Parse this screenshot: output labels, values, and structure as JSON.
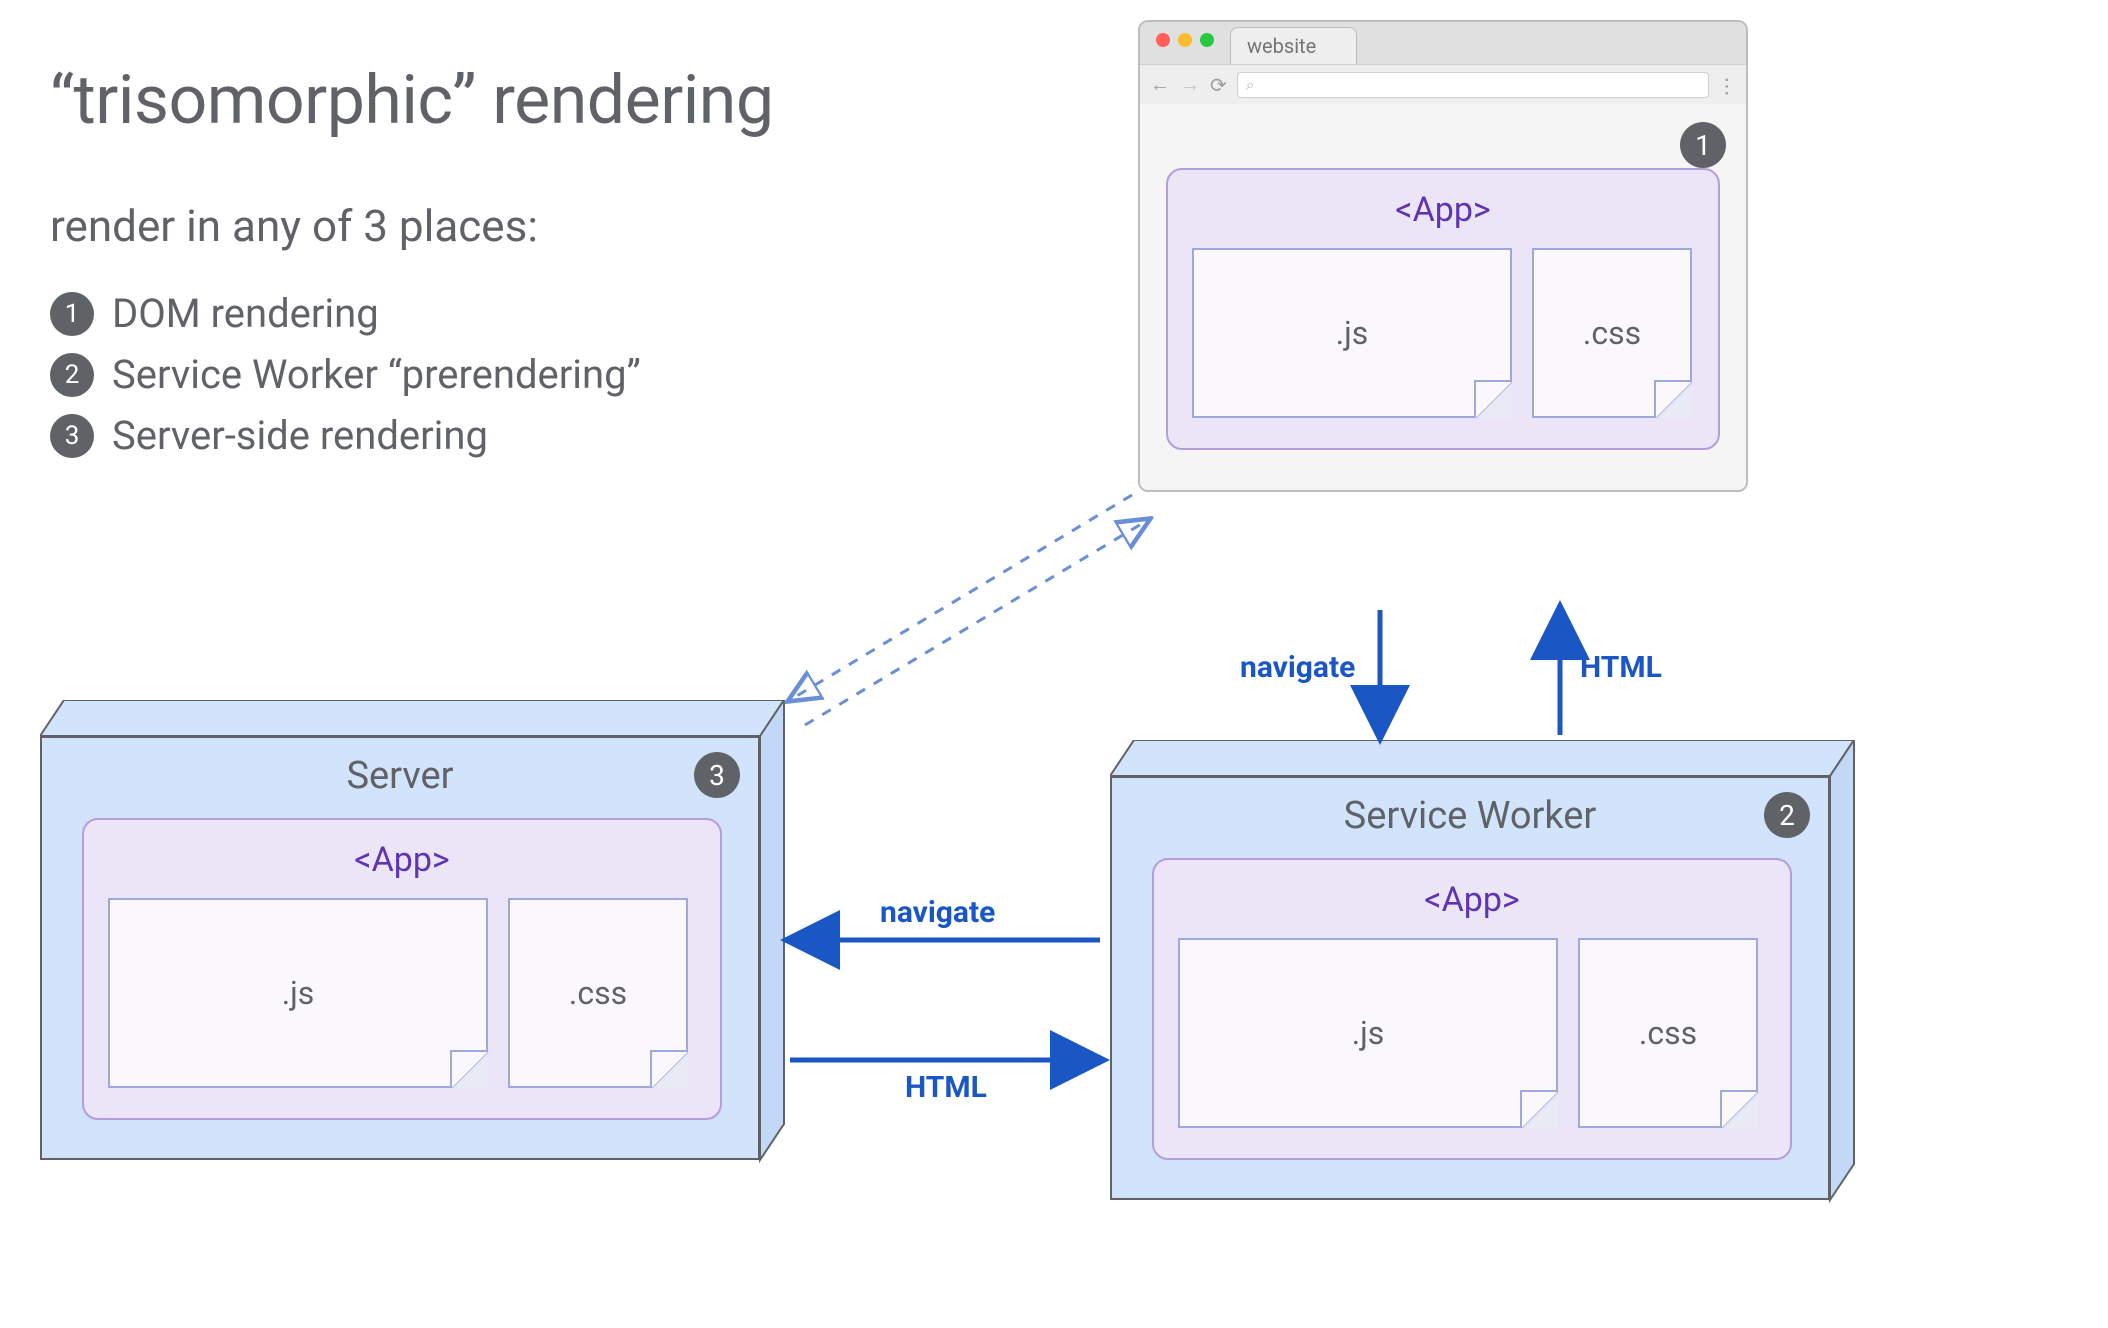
{
  "title": "“trisomorphic” rendering",
  "subtitle": "render in any of 3 places:",
  "list": [
    {
      "num": "1",
      "text": "DOM rendering"
    },
    {
      "num": "2",
      "text": "Service Worker “prerendering”"
    },
    {
      "num": "3",
      "text": "Server-side rendering"
    }
  ],
  "browser": {
    "tab_label": "website",
    "badge": "1",
    "app": {
      "title": "<App>",
      "files": [
        ".js",
        ".css"
      ]
    }
  },
  "server": {
    "label": "Server",
    "badge": "3",
    "app": {
      "title": "<App>",
      "files": [
        ".js",
        ".css"
      ]
    }
  },
  "service_worker": {
    "label": "Service Worker",
    "badge": "2",
    "app": {
      "title": "<App>",
      "files": [
        ".js",
        ".css"
      ]
    }
  },
  "arrows": {
    "browser_to_sw": "navigate",
    "sw_to_browser": "HTML",
    "sw_to_server": "navigate",
    "server_to_sw": "HTML"
  },
  "colors": {
    "accent_blue": "#1a56c4",
    "box_fill": "#d2e3fc",
    "app_fill": "#ece4f7",
    "text": "#5f6368"
  }
}
